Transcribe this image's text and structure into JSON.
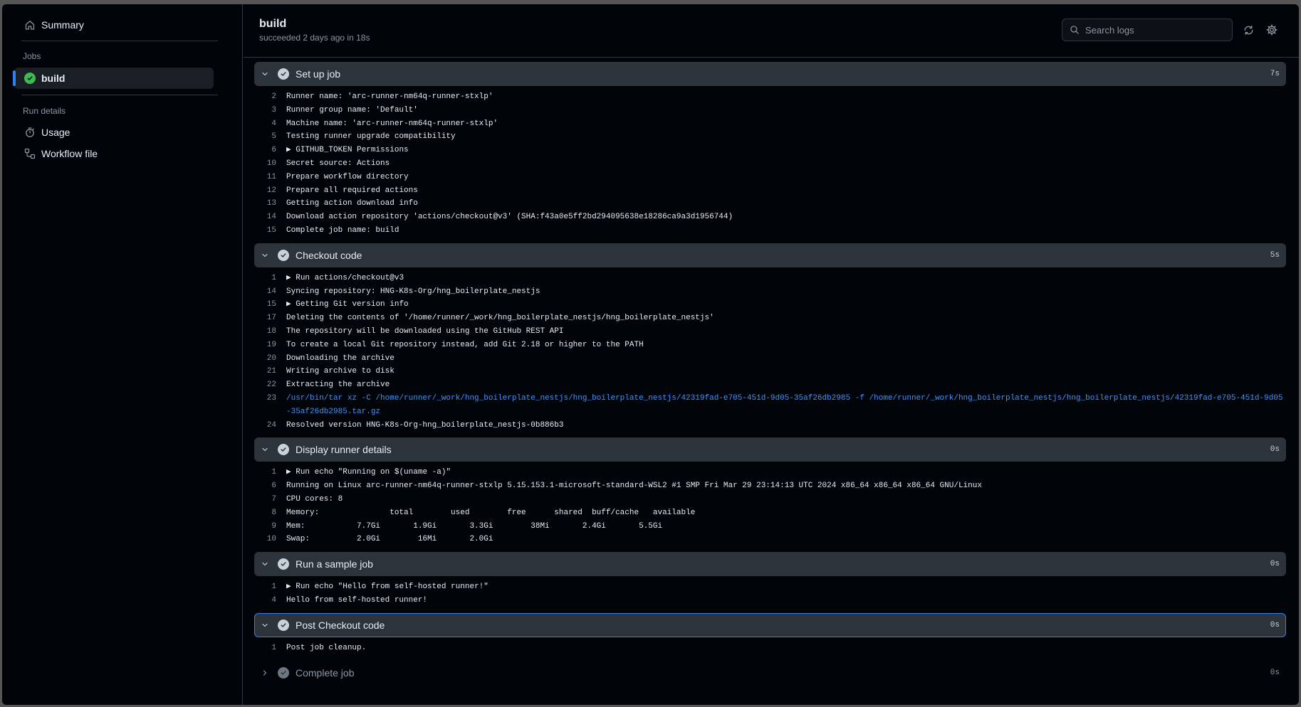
{
  "sidebar": {
    "summary_label": "Summary",
    "jobs_heading": "Jobs",
    "job_item": "build",
    "run_details_heading": "Run details",
    "usage_label": "Usage",
    "workflow_file_label": "Workflow file"
  },
  "header": {
    "title": "build",
    "subtitle": "succeeded 2 days ago in 18s",
    "search_placeholder": "Search logs"
  },
  "steps": [
    {
      "name": "Set up job",
      "time": "7s",
      "lines": [
        {
          "n": "2",
          "t": "Runner name: 'arc-runner-nm64q-runner-stxlp'"
        },
        {
          "n": "3",
          "t": "Runner group name: 'Default'"
        },
        {
          "n": "4",
          "t": "Machine name: 'arc-runner-nm64q-runner-stxlp'"
        },
        {
          "n": "5",
          "t": "Testing runner upgrade compatibility"
        },
        {
          "n": "6",
          "t": "▶ GITHUB_TOKEN Permissions"
        },
        {
          "n": "10",
          "t": "Secret source: Actions"
        },
        {
          "n": "11",
          "t": "Prepare workflow directory"
        },
        {
          "n": "12",
          "t": "Prepare all required actions"
        },
        {
          "n": "13",
          "t": "Getting action download info"
        },
        {
          "n": "14",
          "t": "Download action repository 'actions/checkout@v3' (SHA:f43a0e5ff2bd294095638e18286ca9a3d1956744)"
        },
        {
          "n": "15",
          "t": "Complete job name: build"
        }
      ]
    },
    {
      "name": "Checkout code",
      "time": "5s",
      "lines": [
        {
          "n": "1",
          "t": "▶ Run actions/checkout@v3"
        },
        {
          "n": "14",
          "t": "Syncing repository: HNG-K8s-Org/hng_boilerplate_nestjs"
        },
        {
          "n": "15",
          "t": "▶ Getting Git version info"
        },
        {
          "n": "17",
          "t": "Deleting the contents of '/home/runner/_work/hng_boilerplate_nestjs/hng_boilerplate_nestjs'"
        },
        {
          "n": "18",
          "t": "The repository will be downloaded using the GitHub REST API"
        },
        {
          "n": "19",
          "t": "To create a local Git repository instead, add Git 2.18 or higher to the PATH"
        },
        {
          "n": "20",
          "t": "Downloading the archive"
        },
        {
          "n": "21",
          "t": "Writing archive to disk"
        },
        {
          "n": "22",
          "t": "Extracting the archive"
        },
        {
          "n": "23",
          "t": "/usr/bin/tar xz -C /home/runner/_work/hng_boilerplate_nestjs/hng_boilerplate_nestjs/42319fad-e705-451d-9d05-35af26db2985 -f /home/runner/_work/hng_boilerplate_nestjs/hng_boilerplate_nestjs/42319fad-e705-451d-9d05-35af26db2985.tar.gz",
          "blue": true
        },
        {
          "n": "24",
          "t": "Resolved version HNG-K8s-Org-hng_boilerplate_nestjs-0b886b3"
        }
      ]
    },
    {
      "name": "Display runner details",
      "time": "0s",
      "lines": [
        {
          "n": "1",
          "t": "▶ Run echo \"Running on $(uname -a)\""
        },
        {
          "n": "6",
          "t": "Running on Linux arc-runner-nm64q-runner-stxlp 5.15.153.1-microsoft-standard-WSL2 #1 SMP Fri Mar 29 23:14:13 UTC 2024 x86_64 x86_64 x86_64 GNU/Linux"
        },
        {
          "n": "7",
          "t": "CPU cores: 8"
        },
        {
          "n": "8",
          "t": "Memory:               total        used        free      shared  buff/cache   available"
        },
        {
          "n": "9",
          "t": "Mem:           7.7Gi       1.9Gi       3.3Gi        38Mi       2.4Gi       5.5Gi"
        },
        {
          "n": "10",
          "t": "Swap:          2.0Gi        16Mi       2.0Gi"
        }
      ]
    },
    {
      "name": "Run a sample job",
      "time": "0s",
      "lines": [
        {
          "n": "1",
          "t": "▶ Run echo \"Hello from self-hosted runner!\""
        },
        {
          "n": "4",
          "t": "Hello from self-hosted runner!"
        }
      ]
    },
    {
      "name": "Post Checkout code",
      "time": "0s",
      "focused": true,
      "lines": [
        {
          "n": "1",
          "t": "Post job cleanup."
        }
      ]
    },
    {
      "name": "Complete job",
      "time": "0s",
      "collapsed": true,
      "lines": []
    }
  ]
}
